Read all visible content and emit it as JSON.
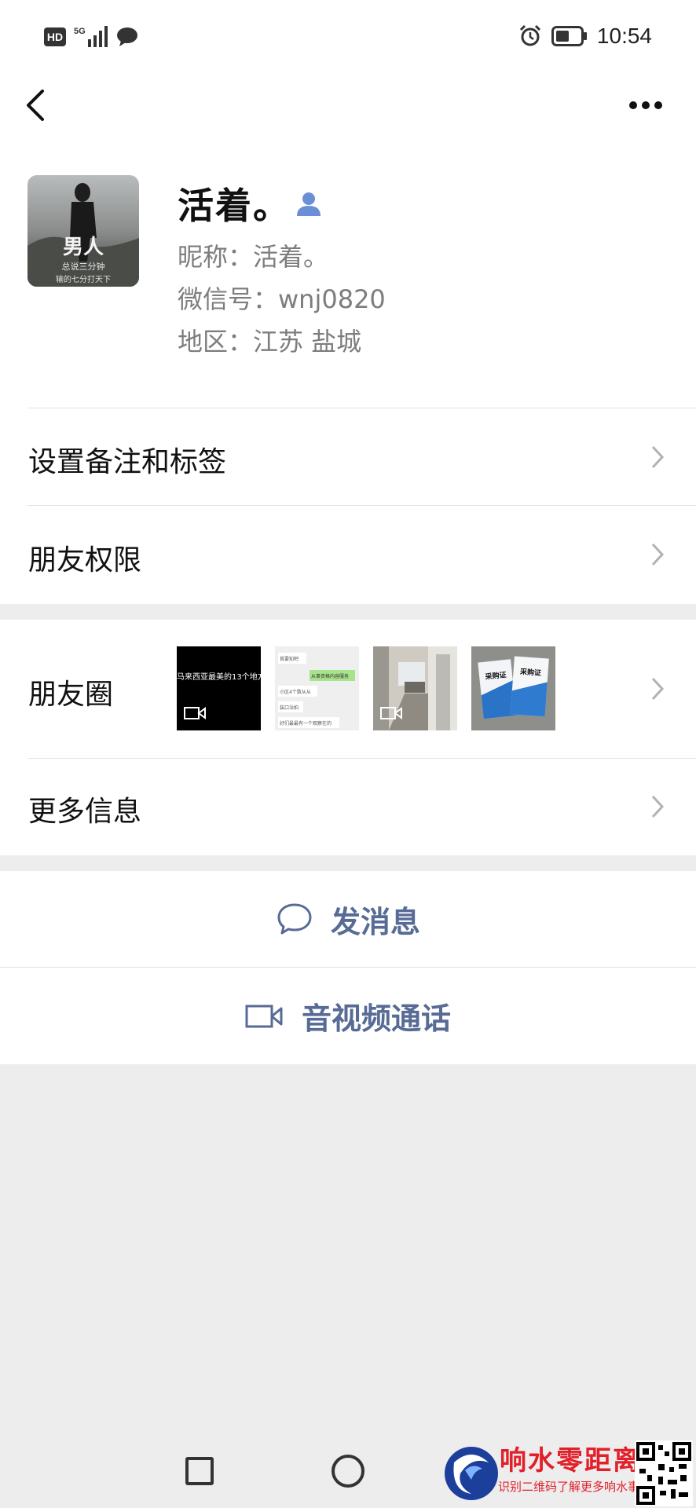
{
  "status_bar": {
    "hd_label": "HD",
    "net_label_top": "5G",
    "time": "10:54"
  },
  "profile": {
    "name": "活着。",
    "nickname_line": "昵称：活着。",
    "wechat_id_line": "微信号：wnj0820",
    "region_line": "地区：江苏  盐城",
    "avatar_text": "男人",
    "avatar_subtext": "总说三分钟",
    "avatar_subtext2": "输的七分打天下"
  },
  "menu": {
    "remarks_label": "设置备注和标签",
    "permissions_label": "朋友权限",
    "moments_label": "朋友圈",
    "more_info_label": "更多信息"
  },
  "moments_thumbs": [
    {
      "caption": "马来西亚最美的13个地方",
      "is_video": true
    },
    {
      "line1": "首要知吧",
      "line2": "从事资格内容服务",
      "line3": "小区4个数从从",
      "line4": "装口治拍",
      "line5": "好们最最有一个观察在的",
      "is_video": false
    },
    {
      "is_video": true
    },
    {
      "card_text": "采购证",
      "is_video": false
    }
  ],
  "actions": {
    "message_label": "发消息",
    "call_label": "音视频通话"
  },
  "watermark": {
    "title": "响水零距离",
    "subtitle": "识别二维码了解更多响水事"
  },
  "colors": {
    "link_blue": "#576b95",
    "background": "#ededed",
    "contact_icon": "#6b8fd6"
  }
}
